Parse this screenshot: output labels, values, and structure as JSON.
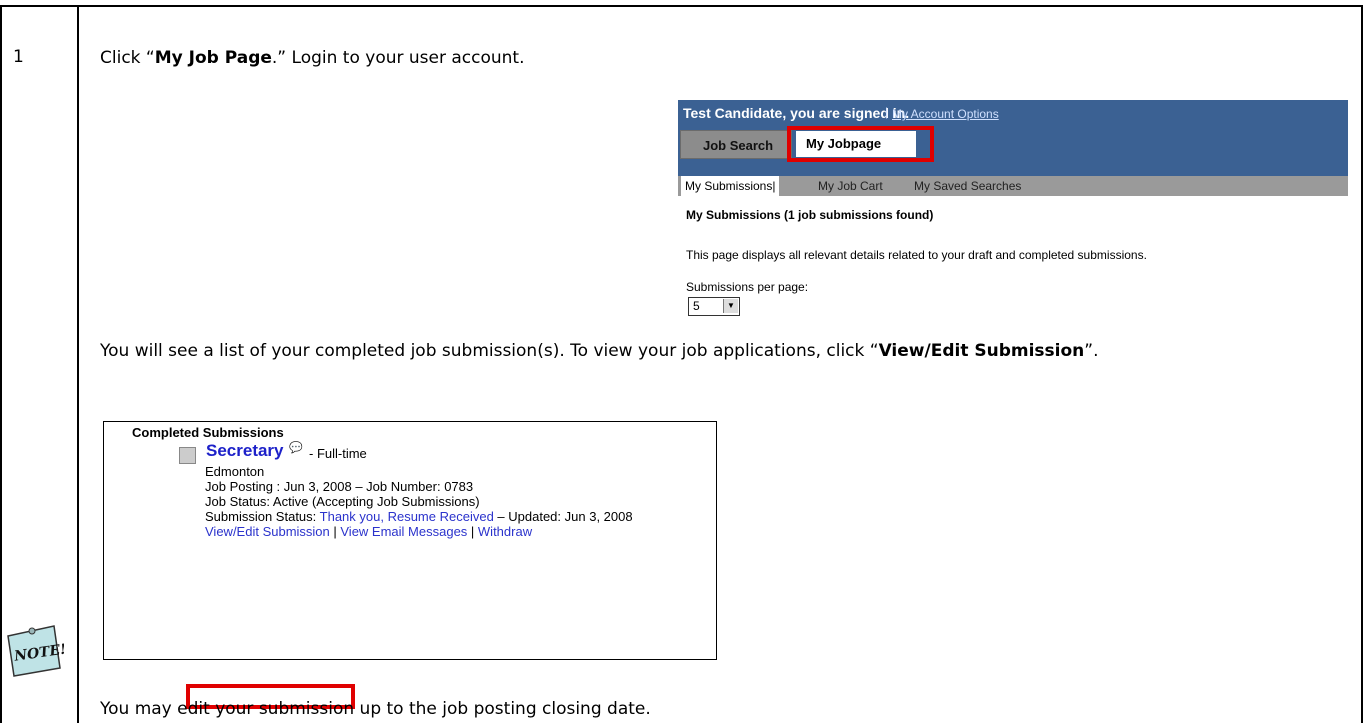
{
  "step": {
    "number": "1"
  },
  "intro": {
    "prefix": "Click “",
    "bold": "My Job Page",
    "suffix": ".”  Login to your user account."
  },
  "shot1": {
    "signed_in": "Test Candidate, you are signed in.",
    "separator": "|",
    "account_options": "My Account Options",
    "tab_job_search": "Job Search",
    "tab_my_jobpage": "My Jobpage",
    "subnav": [
      "My Submissions|",
      "My Job Cart",
      "My Saved Searches"
    ],
    "heading": "My Submissions (1 job submissions found)",
    "description": "This page displays all relevant details related to your draft and completed submissions.",
    "per_page_label": "Submissions per page:",
    "per_page_value": "5"
  },
  "middle": {
    "prefix": "You will see a list of your completed job submission(s).  To view your job applications, click “",
    "bold": "View/Edit Submission",
    "suffix": "”."
  },
  "shot2": {
    "title": "Completed Submissions",
    "job_title": "Secretary",
    "job_type": "- Full-time",
    "location": "Edmonton",
    "posting": "Job Posting : Jun 3, 2008 – Job Number: 0783",
    "status": "Job Status: Active (Accepting Job Submissions)",
    "submission_label": "Submission Status: ",
    "submission_value": "Thank you, Resume Received",
    "updated": " – Updated: Jun 3, 2008",
    "link_view_edit": "View/Edit Submission",
    "link_email": "View Email Messages",
    "link_withdraw": "Withdraw",
    "link_sep": " | "
  },
  "note": {
    "label": "NOTE!"
  },
  "footer": {
    "text": "You may edit your submission up to the job posting closing date."
  },
  "colors": {
    "highlight": "#e00000",
    "header": "#3b6193",
    "link": "#2b33cc"
  }
}
